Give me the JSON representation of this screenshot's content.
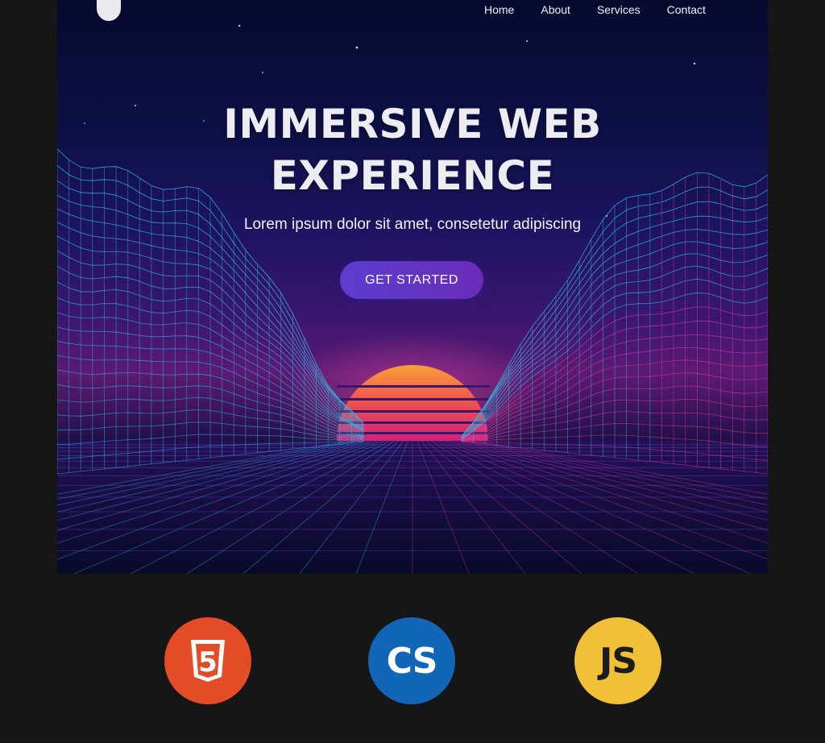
{
  "nav": {
    "items": [
      {
        "label": "Home"
      },
      {
        "label": "About"
      },
      {
        "label": "Services"
      },
      {
        "label": "Contact"
      }
    ]
  },
  "hero": {
    "title_line1": "IMMERSIVE WEB",
    "title_line2": "EXPERIENCE",
    "subtitle": "Lorem ipsum dolor sit amet, consetetur adipiscing",
    "cta_label": "GET STARTED"
  },
  "tech": [
    {
      "name": "html5-icon",
      "label": "5",
      "color": "#e34c26"
    },
    {
      "name": "css-icon",
      "label": "CS",
      "color": "#1266b8"
    },
    {
      "name": "js-icon",
      "label": "JS",
      "color": "#f0c136"
    }
  ],
  "colors": {
    "sun_top": "#f7a23a",
    "sun_bottom": "#d4207c",
    "grid_cyan": "#2fb8e8",
    "grid_magenta": "#d93a9c",
    "cta": "#5b3ed0"
  }
}
